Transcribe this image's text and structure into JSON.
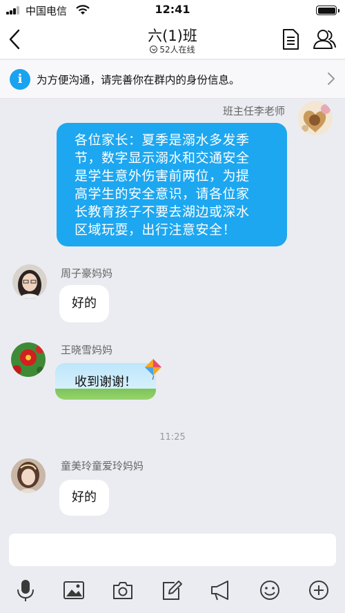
{
  "status_bar": {
    "carrier": "中国电信",
    "time": "12:41"
  },
  "header": {
    "title": "六(1)班",
    "online_count": "52人在线",
    "icons": [
      "back-icon",
      "document-icon",
      "members-icon"
    ]
  },
  "info_bar": {
    "text": "为方便沟通，请完善你在群内的身份信息。",
    "icon": "info-icon"
  },
  "messages": [
    {
      "sender": "班主任李老师",
      "text": "各位家长：夏季是溺水多发季节，数字显示溺水和交通安全是学生意外伤害前两位，为提高学生的安全意识，请各位家长教育孩子不要去湖边或深水区域玩耍，出行注意安全！",
      "lines": [
        "各位家长：夏季是溺水多发季",
        "节，数字显示溺水和交通安全",
        "是学生意外伤害前两位，为提",
        "高学生的安全意识，请各位家",
        "长教育孩子不要去湖边或深水",
        "区域玩耍，出行注意安全！"
      ],
      "self": true
    },
    {
      "sender": "周子豪妈妈",
      "text": "好的"
    },
    {
      "sender": "王晓雪妈妈",
      "text": "收到谢谢！"
    },
    {
      "sender": "童美玲童爱玲妈妈",
      "text": "好的"
    }
  ],
  "timestamp": "11:25",
  "toolbar": [
    "microphone-icon",
    "image-icon",
    "camera-icon",
    "edit-icon",
    "announcement-icon",
    "emoji-icon",
    "add-icon"
  ],
  "colors": {
    "accent": "#1da7f0",
    "background": "#ebecf1"
  }
}
